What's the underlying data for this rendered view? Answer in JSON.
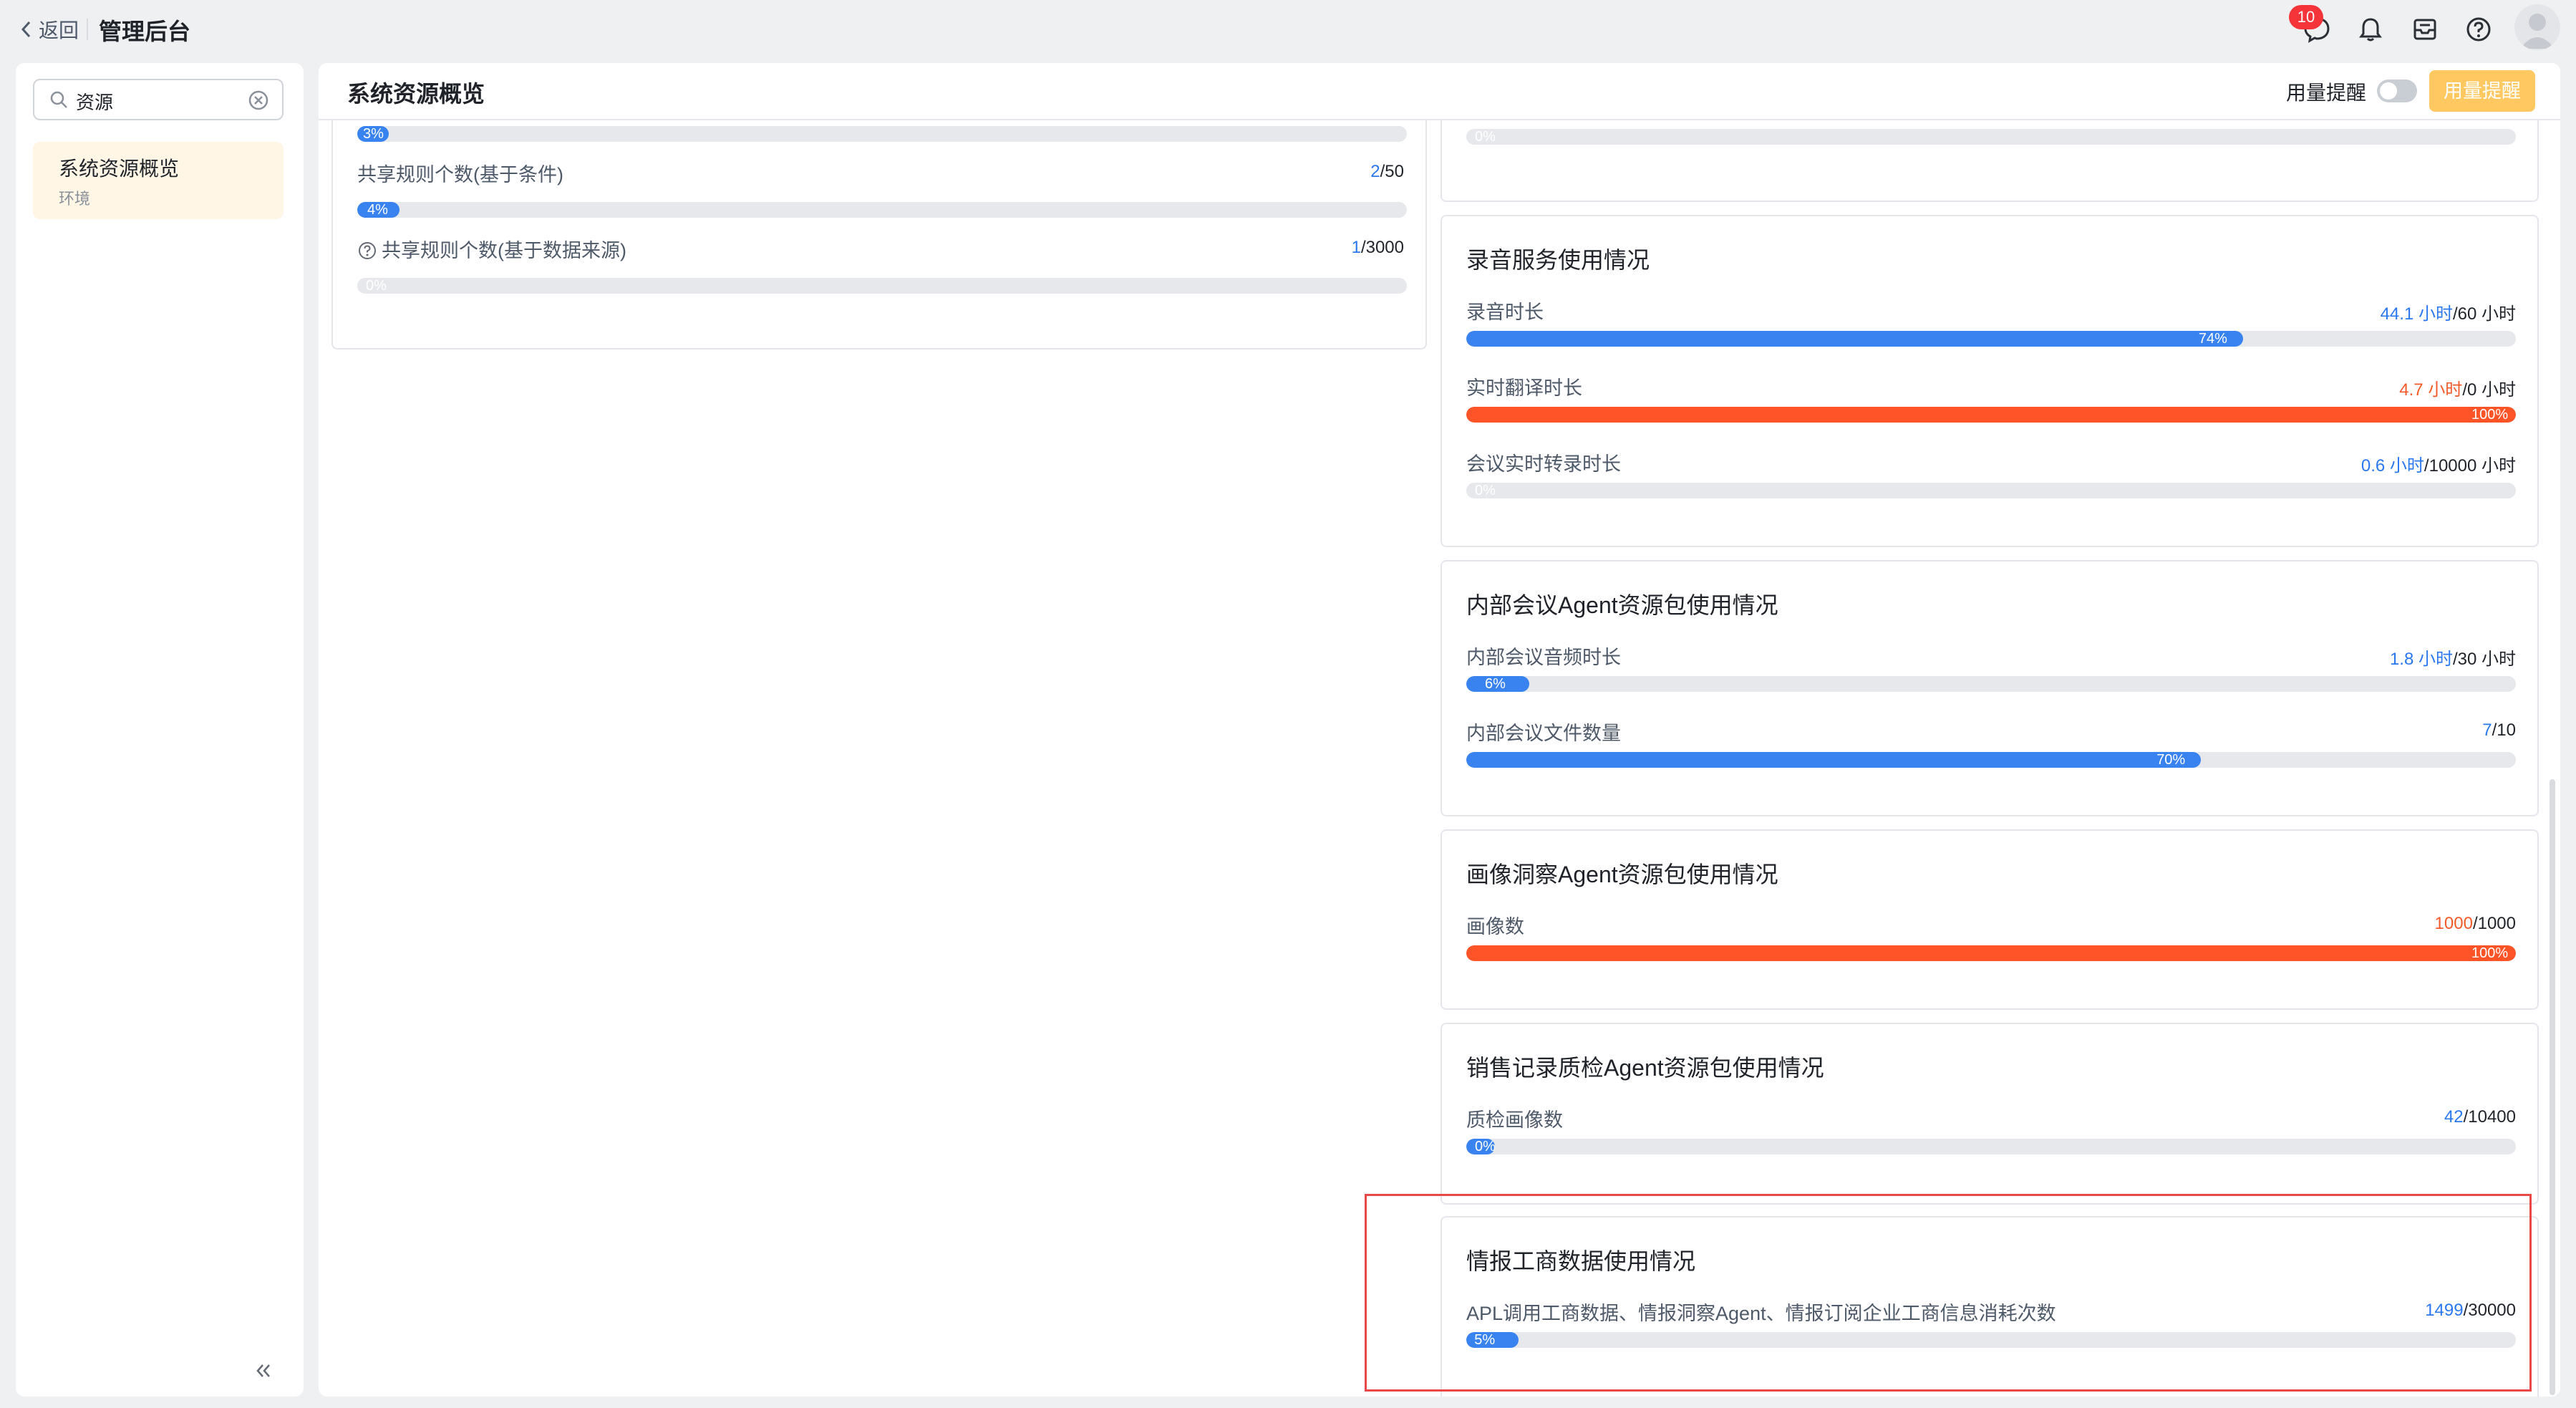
{
  "topbar": {
    "back_label": "返回",
    "app_title": "管理后台",
    "message_badge": "10",
    "icons": [
      "chat-icon",
      "bell-icon",
      "inbox-icon",
      "help-icon",
      "avatar"
    ]
  },
  "sidebar": {
    "search_value": "资源",
    "items": [
      {
        "title": "系统资源概览",
        "subtitle": "环境"
      }
    ],
    "collapse_icon": "double-chevron-left-icon"
  },
  "main": {
    "title": "系统资源概览",
    "usage_alert_toggle_label": "用量提醒",
    "usage_alert_button": "用量提醒",
    "left_card": {
      "metrics": [
        {
          "label": "",
          "used": "",
          "total": "",
          "percent": "3%",
          "fraction": 0.03
        },
        {
          "label": "共享规则个数(基于条件)",
          "used": "2",
          "total": "/50",
          "percent": "4%",
          "fraction": 0.04
        },
        {
          "label": "共享规则个数(基于数据来源)",
          "used": "1",
          "total": "/3000",
          "percent": "0%",
          "fraction": 0.0
        }
      ]
    },
    "right_top_card": {
      "metrics": [
        {
          "percent": "0%",
          "fraction": 0.0
        }
      ]
    },
    "recording_card": {
      "title": "录音服务使用情况",
      "metrics": [
        {
          "label": "录音时长",
          "used": "44.1 小时",
          "total": "/60 小时",
          "percent": "74%",
          "fraction": 0.74,
          "status": "normal"
        },
        {
          "label": "实时翻译时长",
          "used": "4.7 小时",
          "total": "/0 小时",
          "percent": "100%",
          "fraction": 1.0,
          "status": "full"
        },
        {
          "label": "会议实时转录时长",
          "used": "0.6 小时",
          "total": "/10000 小时",
          "percent": "0%",
          "fraction": 0.0,
          "status": "normal"
        }
      ]
    },
    "internal_meeting_card": {
      "title": "内部会议Agent资源包使用情况",
      "metrics": [
        {
          "label": "内部会议音频时长",
          "used": "1.8 小时",
          "total": "/30 小时",
          "percent": "6%",
          "fraction": 0.06,
          "status": "normal"
        },
        {
          "label": "内部会议文件数量",
          "used": "7",
          "total": "/10",
          "percent": "70%",
          "fraction": 0.7,
          "status": "normal"
        }
      ]
    },
    "portrait_card": {
      "title": "画像洞察Agent资源包使用情况",
      "metrics": [
        {
          "label": "画像数",
          "used": "1000",
          "total": "/1000",
          "percent": "100%",
          "fraction": 1.0,
          "status": "full"
        }
      ]
    },
    "sales_qc_card": {
      "title": "销售记录质检Agent资源包使用情况",
      "metrics": [
        {
          "label": "质检画像数",
          "used": "42",
          "total": "/10400",
          "percent": "0%",
          "fraction": 0.004,
          "status": "normal"
        }
      ]
    },
    "business_data_card": {
      "title": "情报工商数据使用情况",
      "metrics": [
        {
          "label": "APL调用工商数据、情报洞察Agent、情报订阅企业工商信息消耗次数",
          "used": "1499",
          "total": "/30000",
          "percent": "5%",
          "fraction": 0.05,
          "status": "normal"
        }
      ]
    }
  },
  "colors": {
    "accent_blue": "#3883f0",
    "danger_orange": "#ff5428",
    "track_gray": "#e6e8eb",
    "warning_button": "#ffc861",
    "highlight_red": "#e84848"
  }
}
